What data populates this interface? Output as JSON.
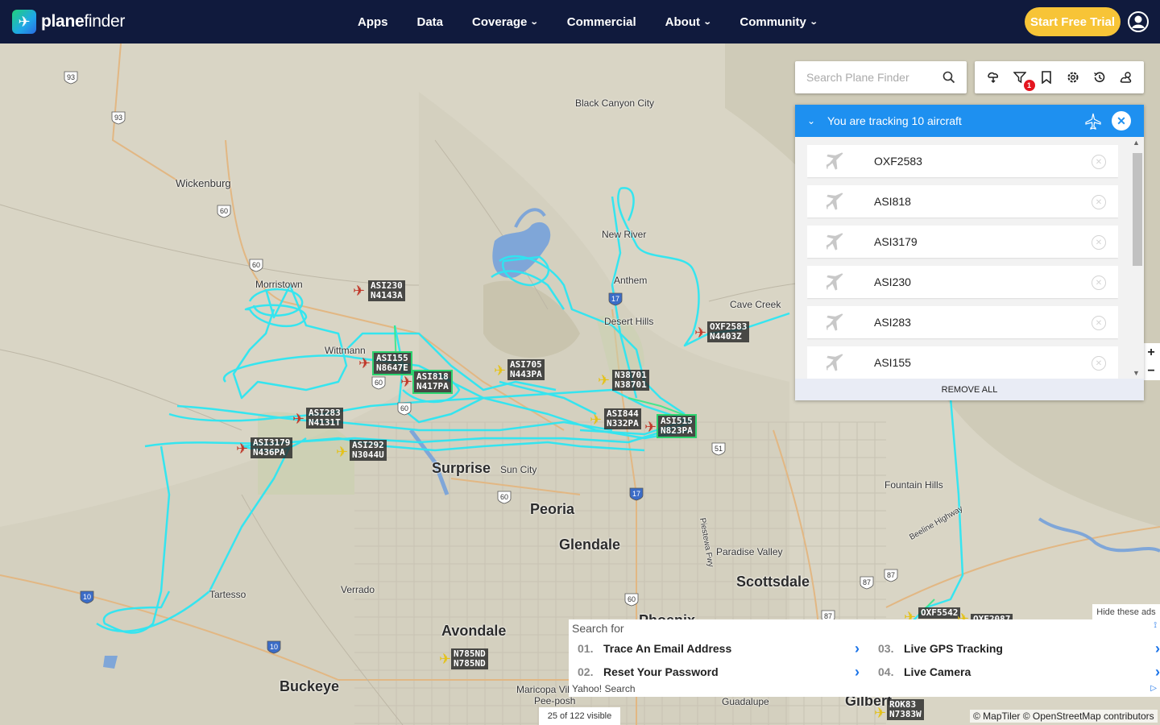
{
  "brand": {
    "name_prefix": "plane",
    "name_suffix": "finder"
  },
  "nav": {
    "items": [
      {
        "label": "Apps",
        "has_menu": false
      },
      {
        "label": "Data",
        "has_menu": false
      },
      {
        "label": "Coverage",
        "has_menu": true
      },
      {
        "label": "Commercial",
        "has_menu": false
      },
      {
        "label": "About",
        "has_menu": true
      },
      {
        "label": "Community",
        "has_menu": true
      }
    ],
    "cta": "Start Free Trial"
  },
  "search": {
    "placeholder": "Search Plane Finder"
  },
  "toolbar": {
    "filter_badge": "1",
    "icons": [
      "layers-icon",
      "filter-icon",
      "bookmark-icon",
      "settings-icon",
      "history-icon",
      "weather-icon"
    ]
  },
  "tracking": {
    "title": "You are tracking 10 aircraft",
    "items": [
      "OXF2583",
      "ASI818",
      "ASI3179",
      "ASI230",
      "ASI283",
      "ASI155"
    ],
    "remove_all": "REMOVE ALL"
  },
  "zoom": {
    "in": "+",
    "out": "−"
  },
  "map": {
    "places": [
      {
        "name": "Black Canyon City",
        "size": "sm"
      },
      {
        "name": "Wickenburg",
        "size": "mid"
      },
      {
        "name": "Morristown",
        "size": "sm"
      },
      {
        "name": "Wittmann",
        "size": "sm"
      },
      {
        "name": "New River",
        "size": "sm"
      },
      {
        "name": "Anthem",
        "size": "sm"
      },
      {
        "name": "Cave Creek",
        "size": "sm"
      },
      {
        "name": "Desert Hills",
        "size": "sm"
      },
      {
        "name": "Surprise",
        "size": "big"
      },
      {
        "name": "Sun City",
        "size": "sm"
      },
      {
        "name": "Peoria",
        "size": "big"
      },
      {
        "name": "Glendale",
        "size": "big"
      },
      {
        "name": "Scottsdale",
        "size": "big"
      },
      {
        "name": "Paradise Valley",
        "size": "sm"
      },
      {
        "name": "Fountain Hills",
        "size": "sm"
      },
      {
        "name": "Tartesso",
        "size": "sm"
      },
      {
        "name": "Verrado",
        "size": "sm"
      },
      {
        "name": "Avondale",
        "size": "big"
      },
      {
        "name": "Buckeye",
        "size": "big"
      },
      {
        "name": "Phoenix",
        "size": "big"
      },
      {
        "name": "Maricopa Vill",
        "size": "sm"
      },
      {
        "name": "Pee-posh",
        "size": "sm"
      },
      {
        "name": "Guadalupe",
        "size": "sm"
      },
      {
        "name": "Gilbert",
        "size": "big"
      },
      {
        "name": "Piestewa Fwy",
        "size": "sm"
      },
      {
        "name": "Beeline Highway",
        "size": "sm"
      }
    ],
    "shields": [
      "93",
      "93",
      "60",
      "60",
      "60",
      "60",
      "17",
      "17",
      "10",
      "10",
      "60",
      "51",
      "87",
      "87",
      "87",
      "60"
    ],
    "aircraft": [
      {
        "callsign": "ASI230",
        "reg": "N4143A",
        "color": "red"
      },
      {
        "callsign": "ASI155",
        "reg": "N8647E",
        "color": "red",
        "tracked": true
      },
      {
        "callsign": "ASI818",
        "reg": "N417PA",
        "color": "red",
        "tracked": true
      },
      {
        "callsign": "ASI705",
        "reg": "N443PA",
        "color": "yellow"
      },
      {
        "callsign": "N38701",
        "reg": "N38701",
        "color": "yellow"
      },
      {
        "callsign": "OXF2583",
        "reg": "N4403Z",
        "color": "red"
      },
      {
        "callsign": "ASI283",
        "reg": "N4131T",
        "color": "red"
      },
      {
        "callsign": "ASI844",
        "reg": "N332PA",
        "color": "yellow"
      },
      {
        "callsign": "ASI515",
        "reg": "N823PA",
        "color": "red",
        "tracked": true
      },
      {
        "callsign": "ASI3179",
        "reg": "N436PA",
        "color": "red"
      },
      {
        "callsign": "ASI292",
        "reg": "N3044U",
        "color": "yellow"
      },
      {
        "callsign": "OXF5542",
        "reg": "",
        "color": "yellow"
      },
      {
        "callsign": "OXF2087",
        "reg": "",
        "color": "yellow"
      },
      {
        "callsign": "N785ND",
        "reg": "N785ND",
        "color": "yellow"
      },
      {
        "callsign": "ROK83",
        "reg": "N7383W",
        "color": "yellow"
      }
    ]
  },
  "ad": {
    "search_for": "Search for",
    "items": [
      {
        "num": "01.",
        "text": "Trace An Email Address"
      },
      {
        "num": "02.",
        "text": "Reset Your Password"
      },
      {
        "num": "03.",
        "text": "Live GPS Tracking"
      },
      {
        "num": "04.",
        "text": "Live Camera"
      }
    ],
    "provider": "Yahoo! Search",
    "hide": "Hide these ads"
  },
  "footer": {
    "visible_count": "25 of 122 visible",
    "attribution": "© MapTiler © OpenStreetMap contributors"
  }
}
